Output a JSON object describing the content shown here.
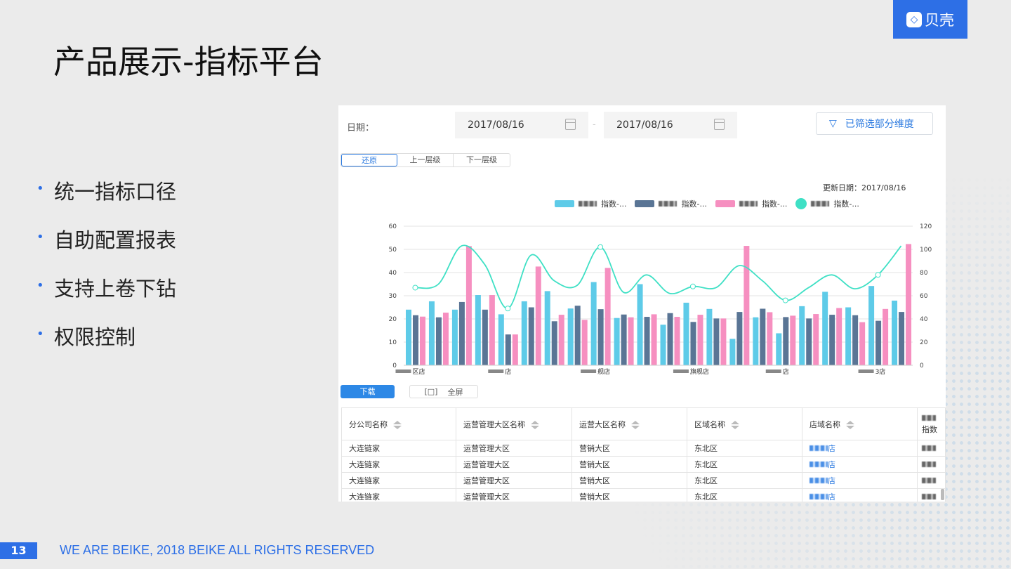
{
  "slide": {
    "title": "产品展示-指标平台",
    "bullets": [
      "统一指标口径",
      "自助配置报表",
      "支持上卷下钻",
      "权限控制"
    ],
    "page_number": "13",
    "footer": "WE ARE BEIKE, 2018 BEIKE ALL RIGHTS RESERVED",
    "logo": {
      "mark": "◇",
      "text": "贝壳"
    },
    "accent": "#2d6fe6"
  },
  "dashboard": {
    "date_label": "日期：",
    "start_date": "2017/08/16",
    "date_sep": "-",
    "end_date": "2017/08/16",
    "filter_button": "已筛选部分维度",
    "drill": [
      "还原",
      "上一层级",
      "下一层级"
    ],
    "update_date": "更新日期：2017/08/16",
    "download_button": "下载",
    "fullscreen_button": "全屏",
    "table": {
      "headers": [
        "分公司名称",
        "运营管理大区名称",
        "运营大区名称",
        "区域名称",
        "店域名称",
        "指数"
      ],
      "rows": [
        [
          "大连链家",
          "运营管理大区",
          "营销大区",
          "东北区",
          "店"
        ],
        [
          "大连链家",
          "运营管理大区",
          "营销大区",
          "东北区",
          "店"
        ],
        [
          "大连链家",
          "运营管理大区",
          "营销大区",
          "东北区",
          "店"
        ],
        [
          "大连链家",
          "运营管理大区",
          "营销大区",
          "东北区",
          "店"
        ]
      ]
    }
  },
  "chart_data": {
    "type": "bar",
    "legend_placement": "top-right",
    "legend": [
      "指数-...",
      "指数-...",
      "指数-...",
      "指数-..."
    ],
    "x_tick_labels": [
      "区店",
      "店",
      "舰店",
      "旗舰店",
      "店",
      "3店"
    ],
    "x_tick_groups": [
      0,
      4,
      8,
      12,
      16,
      20
    ],
    "y_left": {
      "ticks": [
        "0",
        "10",
        "20",
        "30",
        "40",
        "50",
        "60"
      ],
      "range": [
        0,
        60
      ]
    },
    "y_right": {
      "ticks": [
        "0",
        "20",
        "40",
        "60",
        "80",
        "100",
        "120"
      ],
      "range": [
        0,
        120
      ]
    },
    "series": [
      {
        "name": "指数-1",
        "type": "bar",
        "axis": "left",
        "color": "#5ecbe8",
        "values": [
          24,
          27.6,
          24,
          30.3,
          22,
          27.6,
          32,
          24.5,
          35.9,
          20.4,
          35,
          17.5,
          27,
          24.3,
          11.4,
          20.7,
          13.8,
          25.5,
          31.7,
          25,
          34.2,
          27.9
        ]
      },
      {
        "name": "指数-2",
        "type": "bar",
        "axis": "left",
        "color": "#5a7595",
        "values": [
          21.6,
          20.7,
          27.3,
          24,
          13.3,
          25,
          19,
          25.7,
          24.2,
          21.9,
          20.9,
          22.5,
          18.7,
          20.2,
          23,
          24.4,
          20.8,
          20.2,
          21.8,
          21.6,
          19.2,
          23
        ]
      },
      {
        "name": "指数-3",
        "type": "bar",
        "axis": "left",
        "color": "#f68fc0",
        "values": [
          21,
          22.7,
          51.4,
          30.3,
          13.3,
          42.6,
          21.8,
          19.6,
          42,
          20.7,
          22,
          20.9,
          21.8,
          20.2,
          51.5,
          22.9,
          21.4,
          22.1,
          24.7,
          18.6,
          24.3,
          52.3
        ]
      },
      {
        "name": "指数-4",
        "type": "line",
        "axis": "right",
        "color": "#3fe0c5",
        "values": [
          67,
          70,
          103,
          87,
          49,
          95,
          73,
          69,
          102,
          63,
          78,
          62,
          68,
          67,
          86,
          73,
          56,
          67,
          78,
          66,
          78,
          103
        ]
      }
    ]
  }
}
